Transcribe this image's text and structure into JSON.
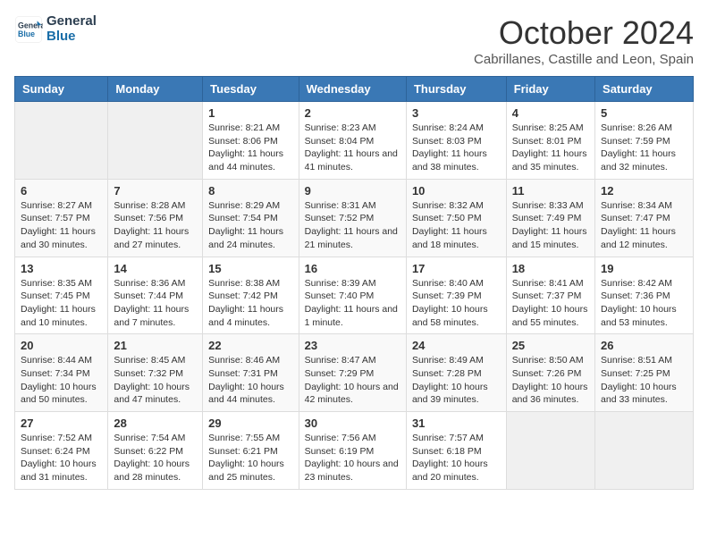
{
  "header": {
    "logo_line1": "General",
    "logo_line2": "Blue",
    "title": "October 2024",
    "subtitle": "Cabrillanes, Castille and Leon, Spain"
  },
  "days_of_week": [
    "Sunday",
    "Monday",
    "Tuesday",
    "Wednesday",
    "Thursday",
    "Friday",
    "Saturday"
  ],
  "weeks": [
    [
      {
        "day": "",
        "sunrise": "",
        "sunset": "",
        "daylight": ""
      },
      {
        "day": "",
        "sunrise": "",
        "sunset": "",
        "daylight": ""
      },
      {
        "day": "1",
        "sunrise": "Sunrise: 8:21 AM",
        "sunset": "Sunset: 8:06 PM",
        "daylight": "Daylight: 11 hours and 44 minutes."
      },
      {
        "day": "2",
        "sunrise": "Sunrise: 8:23 AM",
        "sunset": "Sunset: 8:04 PM",
        "daylight": "Daylight: 11 hours and 41 minutes."
      },
      {
        "day": "3",
        "sunrise": "Sunrise: 8:24 AM",
        "sunset": "Sunset: 8:03 PM",
        "daylight": "Daylight: 11 hours and 38 minutes."
      },
      {
        "day": "4",
        "sunrise": "Sunrise: 8:25 AM",
        "sunset": "Sunset: 8:01 PM",
        "daylight": "Daylight: 11 hours and 35 minutes."
      },
      {
        "day": "5",
        "sunrise": "Sunrise: 8:26 AM",
        "sunset": "Sunset: 7:59 PM",
        "daylight": "Daylight: 11 hours and 32 minutes."
      }
    ],
    [
      {
        "day": "6",
        "sunrise": "Sunrise: 8:27 AM",
        "sunset": "Sunset: 7:57 PM",
        "daylight": "Daylight: 11 hours and 30 minutes."
      },
      {
        "day": "7",
        "sunrise": "Sunrise: 8:28 AM",
        "sunset": "Sunset: 7:56 PM",
        "daylight": "Daylight: 11 hours and 27 minutes."
      },
      {
        "day": "8",
        "sunrise": "Sunrise: 8:29 AM",
        "sunset": "Sunset: 7:54 PM",
        "daylight": "Daylight: 11 hours and 24 minutes."
      },
      {
        "day": "9",
        "sunrise": "Sunrise: 8:31 AM",
        "sunset": "Sunset: 7:52 PM",
        "daylight": "Daylight: 11 hours and 21 minutes."
      },
      {
        "day": "10",
        "sunrise": "Sunrise: 8:32 AM",
        "sunset": "Sunset: 7:50 PM",
        "daylight": "Daylight: 11 hours and 18 minutes."
      },
      {
        "day": "11",
        "sunrise": "Sunrise: 8:33 AM",
        "sunset": "Sunset: 7:49 PM",
        "daylight": "Daylight: 11 hours and 15 minutes."
      },
      {
        "day": "12",
        "sunrise": "Sunrise: 8:34 AM",
        "sunset": "Sunset: 7:47 PM",
        "daylight": "Daylight: 11 hours and 12 minutes."
      }
    ],
    [
      {
        "day": "13",
        "sunrise": "Sunrise: 8:35 AM",
        "sunset": "Sunset: 7:45 PM",
        "daylight": "Daylight: 11 hours and 10 minutes."
      },
      {
        "day": "14",
        "sunrise": "Sunrise: 8:36 AM",
        "sunset": "Sunset: 7:44 PM",
        "daylight": "Daylight: 11 hours and 7 minutes."
      },
      {
        "day": "15",
        "sunrise": "Sunrise: 8:38 AM",
        "sunset": "Sunset: 7:42 PM",
        "daylight": "Daylight: 11 hours and 4 minutes."
      },
      {
        "day": "16",
        "sunrise": "Sunrise: 8:39 AM",
        "sunset": "Sunset: 7:40 PM",
        "daylight": "Daylight: 11 hours and 1 minute."
      },
      {
        "day": "17",
        "sunrise": "Sunrise: 8:40 AM",
        "sunset": "Sunset: 7:39 PM",
        "daylight": "Daylight: 10 hours and 58 minutes."
      },
      {
        "day": "18",
        "sunrise": "Sunrise: 8:41 AM",
        "sunset": "Sunset: 7:37 PM",
        "daylight": "Daylight: 10 hours and 55 minutes."
      },
      {
        "day": "19",
        "sunrise": "Sunrise: 8:42 AM",
        "sunset": "Sunset: 7:36 PM",
        "daylight": "Daylight: 10 hours and 53 minutes."
      }
    ],
    [
      {
        "day": "20",
        "sunrise": "Sunrise: 8:44 AM",
        "sunset": "Sunset: 7:34 PM",
        "daylight": "Daylight: 10 hours and 50 minutes."
      },
      {
        "day": "21",
        "sunrise": "Sunrise: 8:45 AM",
        "sunset": "Sunset: 7:32 PM",
        "daylight": "Daylight: 10 hours and 47 minutes."
      },
      {
        "day": "22",
        "sunrise": "Sunrise: 8:46 AM",
        "sunset": "Sunset: 7:31 PM",
        "daylight": "Daylight: 10 hours and 44 minutes."
      },
      {
        "day": "23",
        "sunrise": "Sunrise: 8:47 AM",
        "sunset": "Sunset: 7:29 PM",
        "daylight": "Daylight: 10 hours and 42 minutes."
      },
      {
        "day": "24",
        "sunrise": "Sunrise: 8:49 AM",
        "sunset": "Sunset: 7:28 PM",
        "daylight": "Daylight: 10 hours and 39 minutes."
      },
      {
        "day": "25",
        "sunrise": "Sunrise: 8:50 AM",
        "sunset": "Sunset: 7:26 PM",
        "daylight": "Daylight: 10 hours and 36 minutes."
      },
      {
        "day": "26",
        "sunrise": "Sunrise: 8:51 AM",
        "sunset": "Sunset: 7:25 PM",
        "daylight": "Daylight: 10 hours and 33 minutes."
      }
    ],
    [
      {
        "day": "27",
        "sunrise": "Sunrise: 7:52 AM",
        "sunset": "Sunset: 6:24 PM",
        "daylight": "Daylight: 10 hours and 31 minutes."
      },
      {
        "day": "28",
        "sunrise": "Sunrise: 7:54 AM",
        "sunset": "Sunset: 6:22 PM",
        "daylight": "Daylight: 10 hours and 28 minutes."
      },
      {
        "day": "29",
        "sunrise": "Sunrise: 7:55 AM",
        "sunset": "Sunset: 6:21 PM",
        "daylight": "Daylight: 10 hours and 25 minutes."
      },
      {
        "day": "30",
        "sunrise": "Sunrise: 7:56 AM",
        "sunset": "Sunset: 6:19 PM",
        "daylight": "Daylight: 10 hours and 23 minutes."
      },
      {
        "day": "31",
        "sunrise": "Sunrise: 7:57 AM",
        "sunset": "Sunset: 6:18 PM",
        "daylight": "Daylight: 10 hours and 20 minutes."
      },
      {
        "day": "",
        "sunrise": "",
        "sunset": "",
        "daylight": ""
      },
      {
        "day": "",
        "sunrise": "",
        "sunset": "",
        "daylight": ""
      }
    ]
  ]
}
